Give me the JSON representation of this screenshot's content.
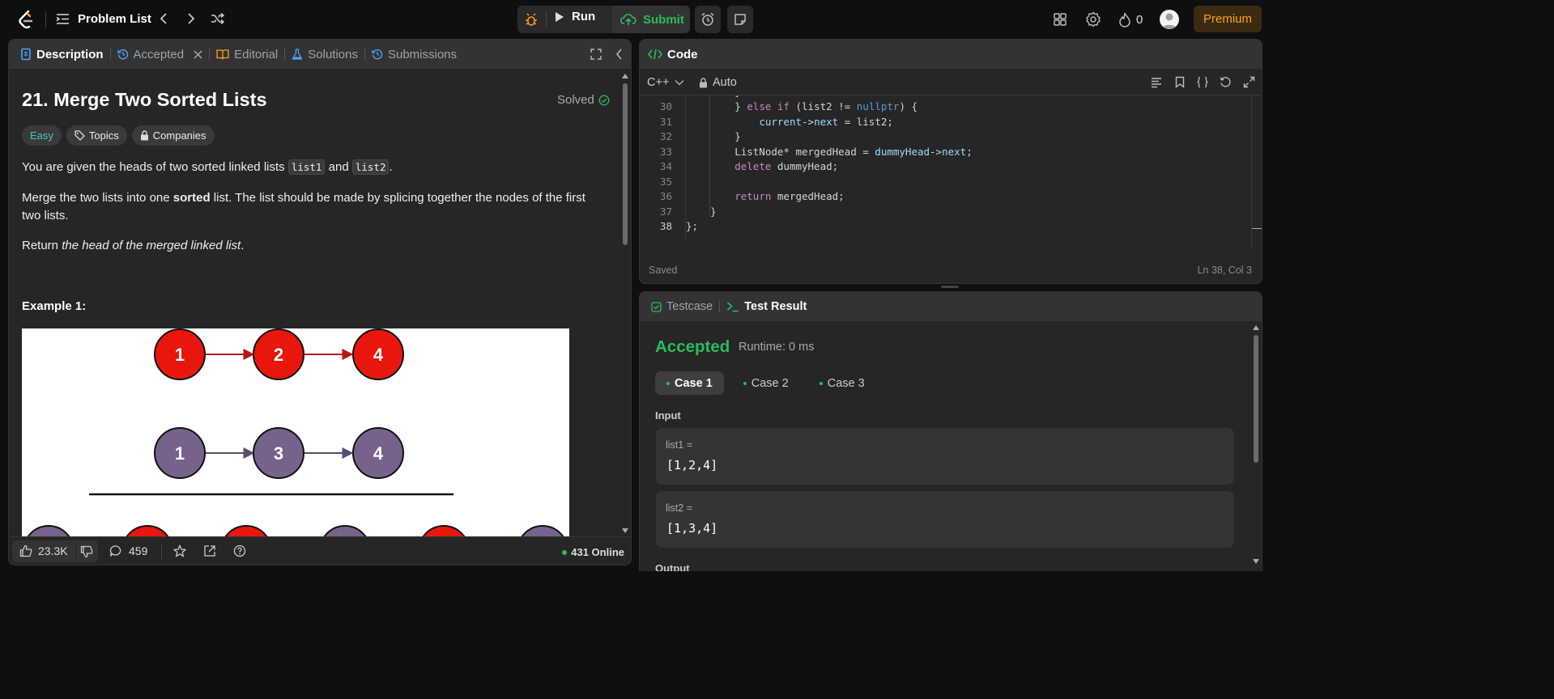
{
  "topbar": {
    "problem_list": "Problem List",
    "run": "Run",
    "submit": "Submit",
    "streak": "0",
    "premium": "Premium"
  },
  "left": {
    "tabs": {
      "description": "Description",
      "accepted": "Accepted",
      "editorial": "Editorial",
      "solutions": "Solutions",
      "submissions": "Submissions"
    },
    "title": "21. Merge Two Sorted Lists",
    "solved": "Solved",
    "tags": {
      "difficulty": "Easy",
      "topics": "Topics",
      "companies": "Companies"
    },
    "p1_before": "You are given the heads of two sorted linked lists ",
    "p1_code1": "list1",
    "p1_and": " and ",
    "p1_code2": "list2",
    "p1_end": ".",
    "p2_before": "Merge the two lists into one ",
    "p2_bold": "sorted",
    "p2_after": " list. The list should be made by splicing together the nodes of the first two lists.",
    "p3_before": "Return ",
    "p3_italic": "the head of the merged linked list",
    "p3_end": ".",
    "example_title": "Example 1:",
    "diagram": {
      "row1": [
        "1",
        "2",
        "4"
      ],
      "row2": [
        "1",
        "3",
        "4"
      ]
    },
    "footer": {
      "likes": "23.3K",
      "comments": "459",
      "online": "431 Online"
    },
    "colors": {
      "red_node": "#e8160c",
      "purple_node": "#77628c"
    }
  },
  "code": {
    "title": "Code",
    "language": "C++",
    "mode": "Auto",
    "status": "Saved",
    "position": "Ln 38, Col 3",
    "lines": [
      {
        "n": "30",
        "text": "        } else if (list2 != nullptr) {"
      },
      {
        "n": "31",
        "text": "            current->next = list2;"
      },
      {
        "n": "32",
        "text": "        }"
      },
      {
        "n": "33",
        "text": "        ListNode* mergedHead = dummyHead->next;"
      },
      {
        "n": "34",
        "text": "        delete dummyHead;"
      },
      {
        "n": "35",
        "text": ""
      },
      {
        "n": "36",
        "text": "        return mergedHead;"
      },
      {
        "n": "37",
        "text": "    }"
      },
      {
        "n": "38",
        "text": "};"
      }
    ]
  },
  "result": {
    "tabs": {
      "testcase": "Testcase",
      "test_result": "Test Result"
    },
    "status": "Accepted",
    "runtime": "Runtime: 0 ms",
    "cases": [
      "Case 1",
      "Case 2",
      "Case 3"
    ],
    "input_label": "Input",
    "inputs": [
      {
        "label": "list1 =",
        "value": "[1,2,4]"
      },
      {
        "label": "list2 =",
        "value": "[1,3,4]"
      }
    ],
    "output_partial": "Output",
    "accent": "#2cbb5d"
  }
}
